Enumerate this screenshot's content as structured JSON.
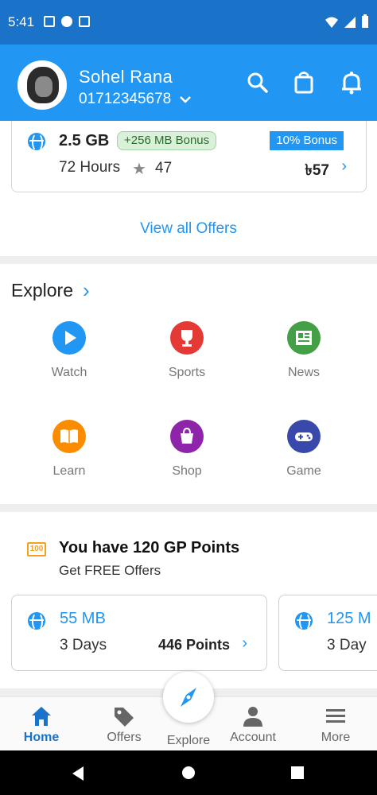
{
  "status_bar": {
    "time": "5:41"
  },
  "header": {
    "name": "Sohel Rana",
    "phone": "01712345678",
    "icons": [
      "search-icon",
      "shopping-bag-icon",
      "bell-icon"
    ]
  },
  "offer_card": {
    "data": "2.5 GB",
    "bonus": "+256 MB Bonus",
    "percent_bonus": "10% Bonus",
    "validity": "72 Hours",
    "rating": "47",
    "price": "৳57"
  },
  "view_all": "View all Offers",
  "explore": {
    "title": "Explore",
    "items": [
      {
        "label": "Watch",
        "icon": "play-icon",
        "color": "#2196f3"
      },
      {
        "label": "Sports",
        "icon": "trophy-icon",
        "color": "#e53935"
      },
      {
        "label": "News",
        "icon": "newspaper-icon",
        "color": "#43a047"
      },
      {
        "label": "Learn",
        "icon": "book-icon",
        "color": "#fb8c00"
      },
      {
        "label": "Shop",
        "icon": "shopping-bag-icon",
        "color": "#8e24aa"
      },
      {
        "label": "Game",
        "icon": "gamepad-icon",
        "color": "#3949ab"
      }
    ]
  },
  "points": {
    "icon_text": "100",
    "title": "You have 120 GP Points",
    "subtitle": "Get FREE Offers",
    "offers": [
      {
        "data": "55 MB",
        "validity": "3 Days",
        "points": "446 Points"
      },
      {
        "data": "125 M",
        "validity": "3 Day"
      }
    ]
  },
  "bottom_nav": {
    "items": [
      {
        "label": "Home",
        "icon": "home-icon"
      },
      {
        "label": "Offers",
        "icon": "tag-icon"
      },
      {
        "label": "Explore",
        "icon": "compass-icon"
      },
      {
        "label": "Account",
        "icon": "person-icon"
      },
      {
        "label": "More",
        "icon": "menu-icon"
      }
    ],
    "active": "Home"
  },
  "colors": {
    "primary": "#2196f3",
    "status_bar": "#1a73c8",
    "accent_orange": "#f4a020"
  }
}
